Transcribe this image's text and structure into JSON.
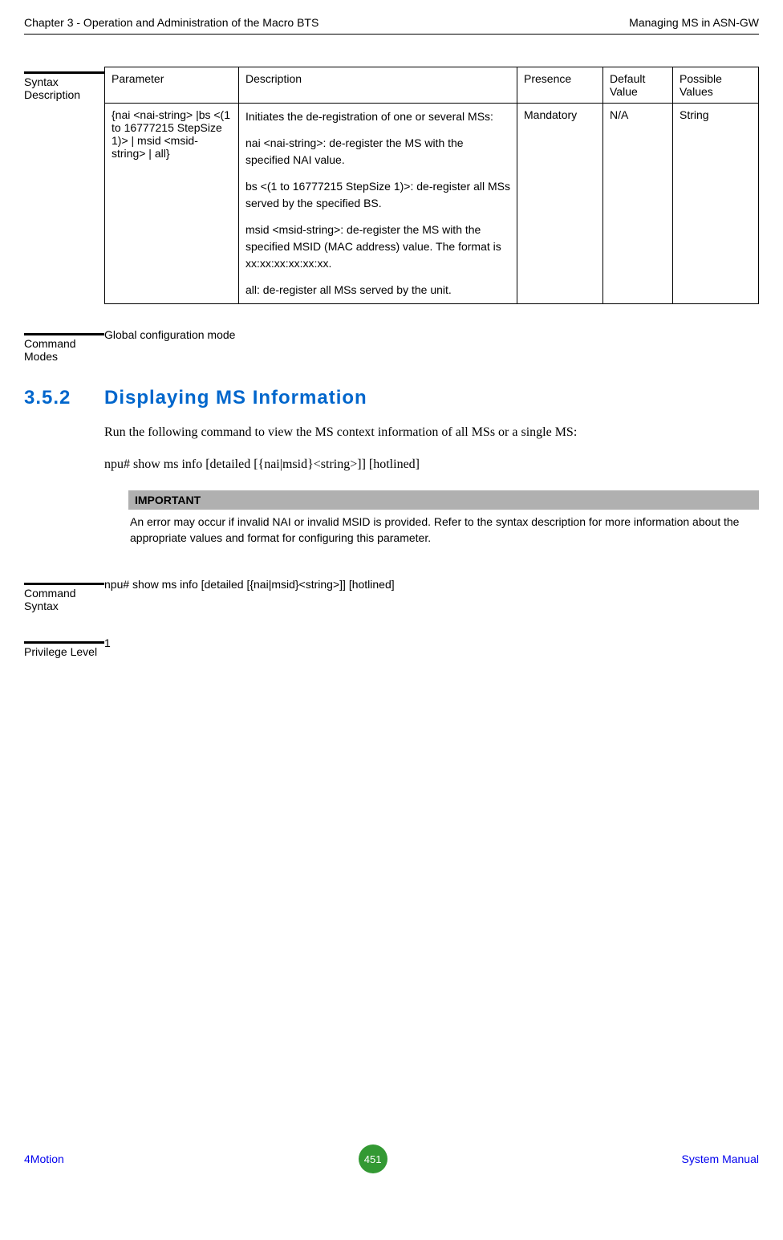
{
  "header": {
    "left": "Chapter 3 - Operation and Administration of the Macro BTS",
    "right": "Managing MS in ASN-GW"
  },
  "syntax_desc": {
    "label": "Syntax Description",
    "headers": {
      "parameter": "Parameter",
      "description": "Description",
      "presence": "Presence",
      "default": "Default Value",
      "possible": "Possible Values"
    },
    "row": {
      "parameter": "{nai <nai-string> |bs <(1 to 16777215 StepSize 1)> | msid <msid-string> |  all}",
      "desc_intro": "Initiates the de-registration of one or several MSs:",
      "desc_nai": "nai <nai-string>: de-register the MS with the specified NAI value.",
      "desc_bs": "bs <(1 to 16777215 StepSize 1)>: de-register all MSs served by the specified BS.",
      "desc_msid": "msid <msid-string>: de-register the MS with the specified MSID (MAC address) value. The format is xx:xx:xx:xx:xx:xx.",
      "desc_all": "all: de-register all MSs served by the unit.",
      "presence": "Mandatory",
      "default": "N/A",
      "possible": "String"
    }
  },
  "command_modes": {
    "label": "Command Modes",
    "value": "Global configuration mode"
  },
  "section": {
    "number": "3.5.2",
    "title": "Displaying MS Information",
    "body1": "Run the following command to view the MS context information of all MSs or a single MS:",
    "body2": "npu# show ms info [detailed [{nai|msid}<string>]] [hotlined]"
  },
  "important": {
    "header": "IMPORTANT",
    "text": "An error may occur if invalid NAI or invalid MSID is provided.  Refer to the syntax description for more information about the appropriate values and format for configuring this parameter."
  },
  "command_syntax": {
    "label": "Command Syntax",
    "value": "npu# show ms info [detailed [{nai|msid}<string>]] [hotlined]"
  },
  "privilege": {
    "label": "Privilege Level",
    "value": "1"
  },
  "footer": {
    "left": "4Motion",
    "page": "451",
    "right": "System Manual"
  }
}
